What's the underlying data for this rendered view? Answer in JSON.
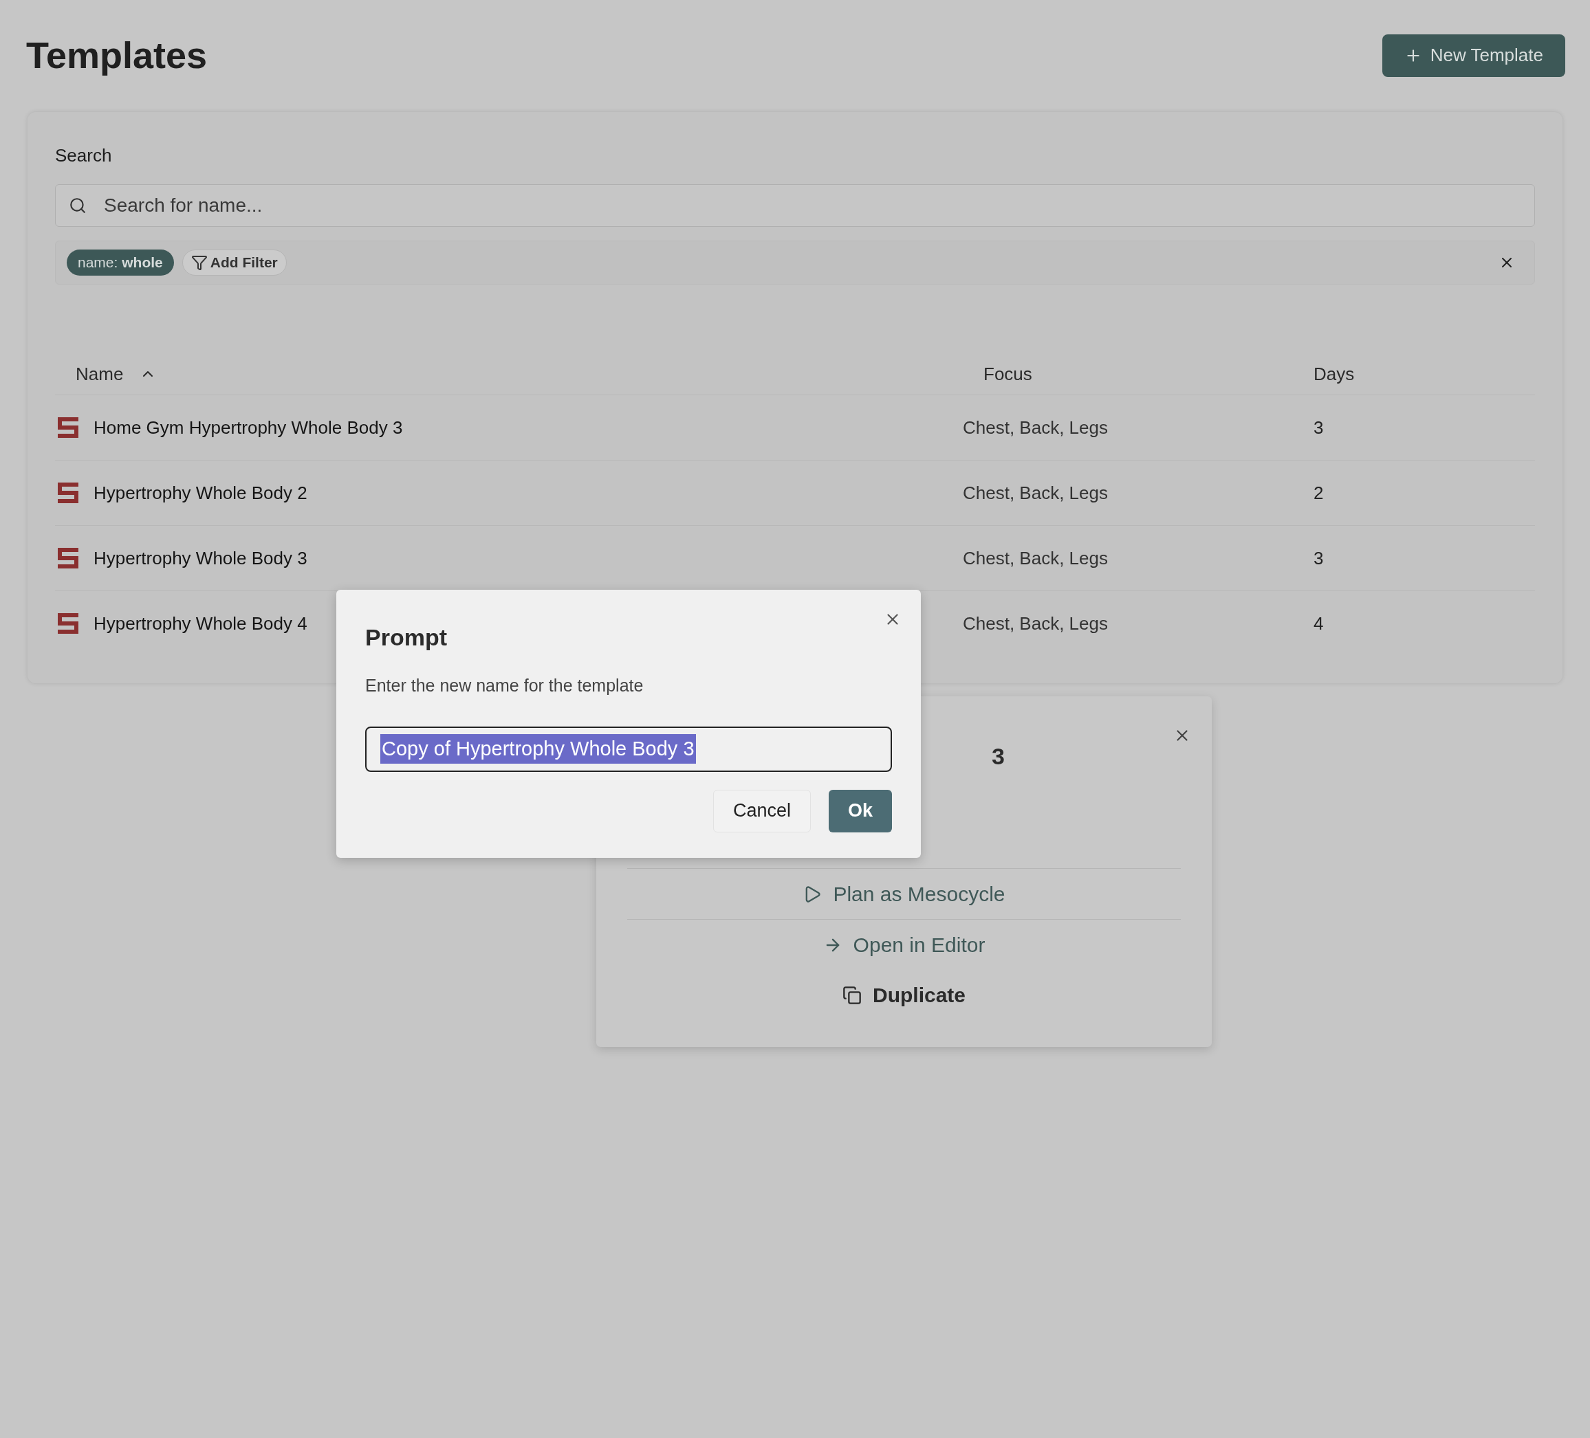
{
  "page": {
    "title": "Templates",
    "new_button": "New Template"
  },
  "search": {
    "label": "Search",
    "placeholder": "Search for name..."
  },
  "filters": [
    {
      "key": "name:",
      "value": "whole"
    }
  ],
  "add_filter": "Add Filter",
  "table": {
    "columns": [
      {
        "label": "Name",
        "sort_ascending": true
      },
      {
        "label": "Focus"
      },
      {
        "label": "Days"
      }
    ],
    "rows": [
      {
        "name": "Home Gym Hypertrophy Whole Body 3",
        "focus": "Chest, Back, Legs",
        "days": "3"
      },
      {
        "name": "Hypertrophy Whole Body 2",
        "focus": "Chest, Back, Legs",
        "days": "2"
      },
      {
        "name": "Hypertrophy Whole Body 3",
        "focus": "Chest, Back, Legs",
        "days": "3"
      },
      {
        "name": "Hypertrophy Whole Body 4",
        "focus": "Chest, Back, Legs",
        "days": "4"
      }
    ]
  },
  "detail": {
    "title_visible": "3",
    "actions": [
      {
        "kind": "plan",
        "label": "Plan as Mesocycle"
      },
      {
        "kind": "editor",
        "label": "Open in Editor"
      },
      {
        "kind": "duplicate",
        "label": "Duplicate"
      }
    ]
  },
  "prompt": {
    "title": "Prompt",
    "message": "Enter the new name for the template",
    "value": "Copy of Hypertrophy Whole Body 3",
    "value_selected": true,
    "buttons": [
      {
        "label": "Cancel",
        "kind": "secondary"
      },
      {
        "label": "Ok",
        "kind": "primary"
      }
    ]
  }
}
